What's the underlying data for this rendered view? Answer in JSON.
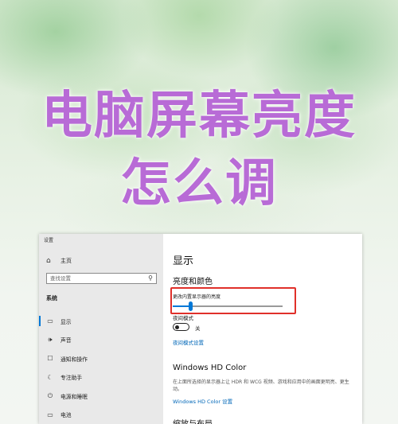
{
  "overlay": {
    "title_line1": "电脑屏幕亮度",
    "title_line2": "怎么调"
  },
  "window": {
    "title": "设置"
  },
  "sidebar": {
    "home": {
      "label": "主页",
      "icon": "home-icon"
    },
    "search_placeholder": "查找设置",
    "section": "系统",
    "items": [
      {
        "label": "显示",
        "icon": "display-icon",
        "active": true
      },
      {
        "label": "声音",
        "icon": "speaker-icon"
      },
      {
        "label": "通知和操作",
        "icon": "notification-icon"
      },
      {
        "label": "专注助手",
        "icon": "moon-icon"
      },
      {
        "label": "电源和睡眠",
        "icon": "power-icon"
      },
      {
        "label": "电池",
        "icon": "battery-icon"
      }
    ]
  },
  "content": {
    "page_title": "显示",
    "brightness_section": "亮度和颜色",
    "brightness_label": "更改内置显示器的亮度",
    "brightness_level": 0.16,
    "night_light_label": "夜间模式",
    "night_light_state": "关",
    "night_light_settings_link": "夜间模式设置",
    "hd_title": "Windows HD Color",
    "hd_description": "在上面所选择的显示器上让 HDR 和 WCG 视频、游戏和应用中的画面更明亮、更生动。",
    "hd_link": "Windows HD Color 设置",
    "next_section_partial": "缩放与布局"
  },
  "colors": {
    "accent": "#0078d7",
    "link": "#0067b8",
    "highlight_border": "#e0302a",
    "title_text": "#b86bd6"
  }
}
